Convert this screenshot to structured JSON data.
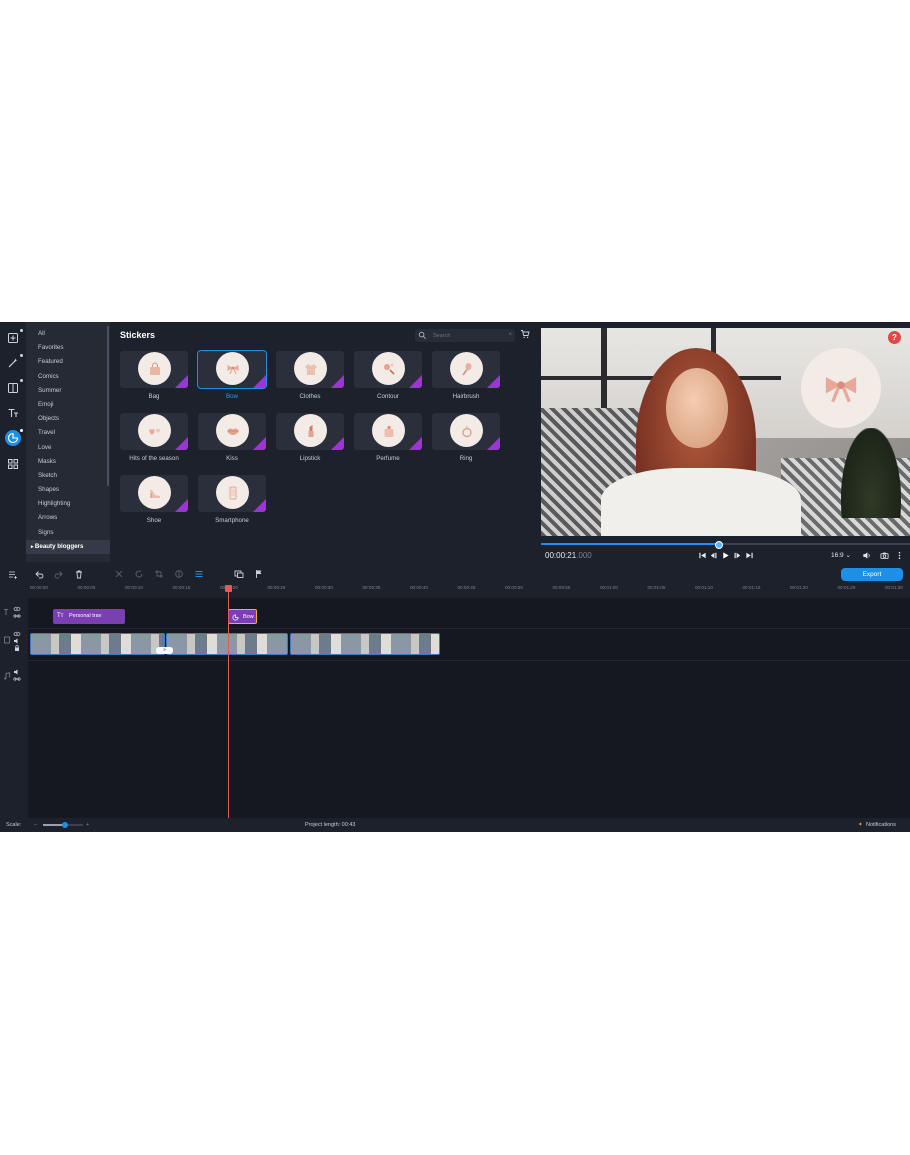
{
  "categories": [
    {
      "label": "All"
    },
    {
      "label": "Favorites"
    },
    {
      "label": "Featured"
    },
    {
      "label": "Comics"
    },
    {
      "label": "Summer"
    },
    {
      "label": "Emoji"
    },
    {
      "label": "Objects"
    },
    {
      "label": "Travel"
    },
    {
      "label": "Love"
    },
    {
      "label": "Masks"
    },
    {
      "label": "Sketch"
    },
    {
      "label": "Shapes"
    },
    {
      "label": "Highlighting"
    },
    {
      "label": "Arrows"
    },
    {
      "label": "Signs"
    },
    {
      "label": "Beauty bloggers"
    }
  ],
  "panel": {
    "title": "Stickers",
    "search_placeholder": "Search",
    "search_clear": "×"
  },
  "stickers": [
    {
      "label": "Bag",
      "icon": "bag-icon"
    },
    {
      "label": "Bow",
      "icon": "bow-icon"
    },
    {
      "label": "Clothes",
      "icon": "clothes-icon"
    },
    {
      "label": "Contour",
      "icon": "contour-icon"
    },
    {
      "label": "Hairbrush",
      "icon": "hairbrush-icon"
    },
    {
      "label": "Hits of the season",
      "icon": "hearts-icon"
    },
    {
      "label": "Kiss",
      "icon": "lips-icon"
    },
    {
      "label": "Lipstick",
      "icon": "lipstick-icon"
    },
    {
      "label": "Perfume",
      "icon": "perfume-icon"
    },
    {
      "label": "Ring",
      "icon": "ring-icon"
    },
    {
      "label": "Shoe",
      "icon": "shoe-icon"
    },
    {
      "label": "Smartphone",
      "icon": "smartphone-icon"
    }
  ],
  "player": {
    "time_main": "00:00:21",
    "time_ms": ".000",
    "aspect": "16:9 ⌄",
    "progress": 0.48,
    "help": "?"
  },
  "toolbar": {
    "export_label": "Export"
  },
  "timeline": {
    "ticks": [
      "00:00:00",
      "00:00:05",
      "00:00:10",
      "00:00:15",
      "00:00:20",
      "00:00:25",
      "00:00:30",
      "00:00:35",
      "00:00:40",
      "00:00:45",
      "00:00:50",
      "00:00:55",
      "00:01:00",
      "00:01:05",
      "00:01:10",
      "00:01:15",
      "00:01:20",
      "00:01:25",
      "00:01:30"
    ],
    "text_clip": "Personal trav",
    "sticker_clip": "Bow",
    "transition": "»"
  },
  "status": {
    "scale_label": "Scale:",
    "scale_value": 0.55,
    "project_length": "Project length:  00:43",
    "notifications": "Notifications"
  },
  "colors": {
    "accent": "#1e8fe6",
    "premium_badge": "#9b35d6",
    "clip_purple": "#7a3fb0",
    "playhead": "#e05a5a"
  }
}
